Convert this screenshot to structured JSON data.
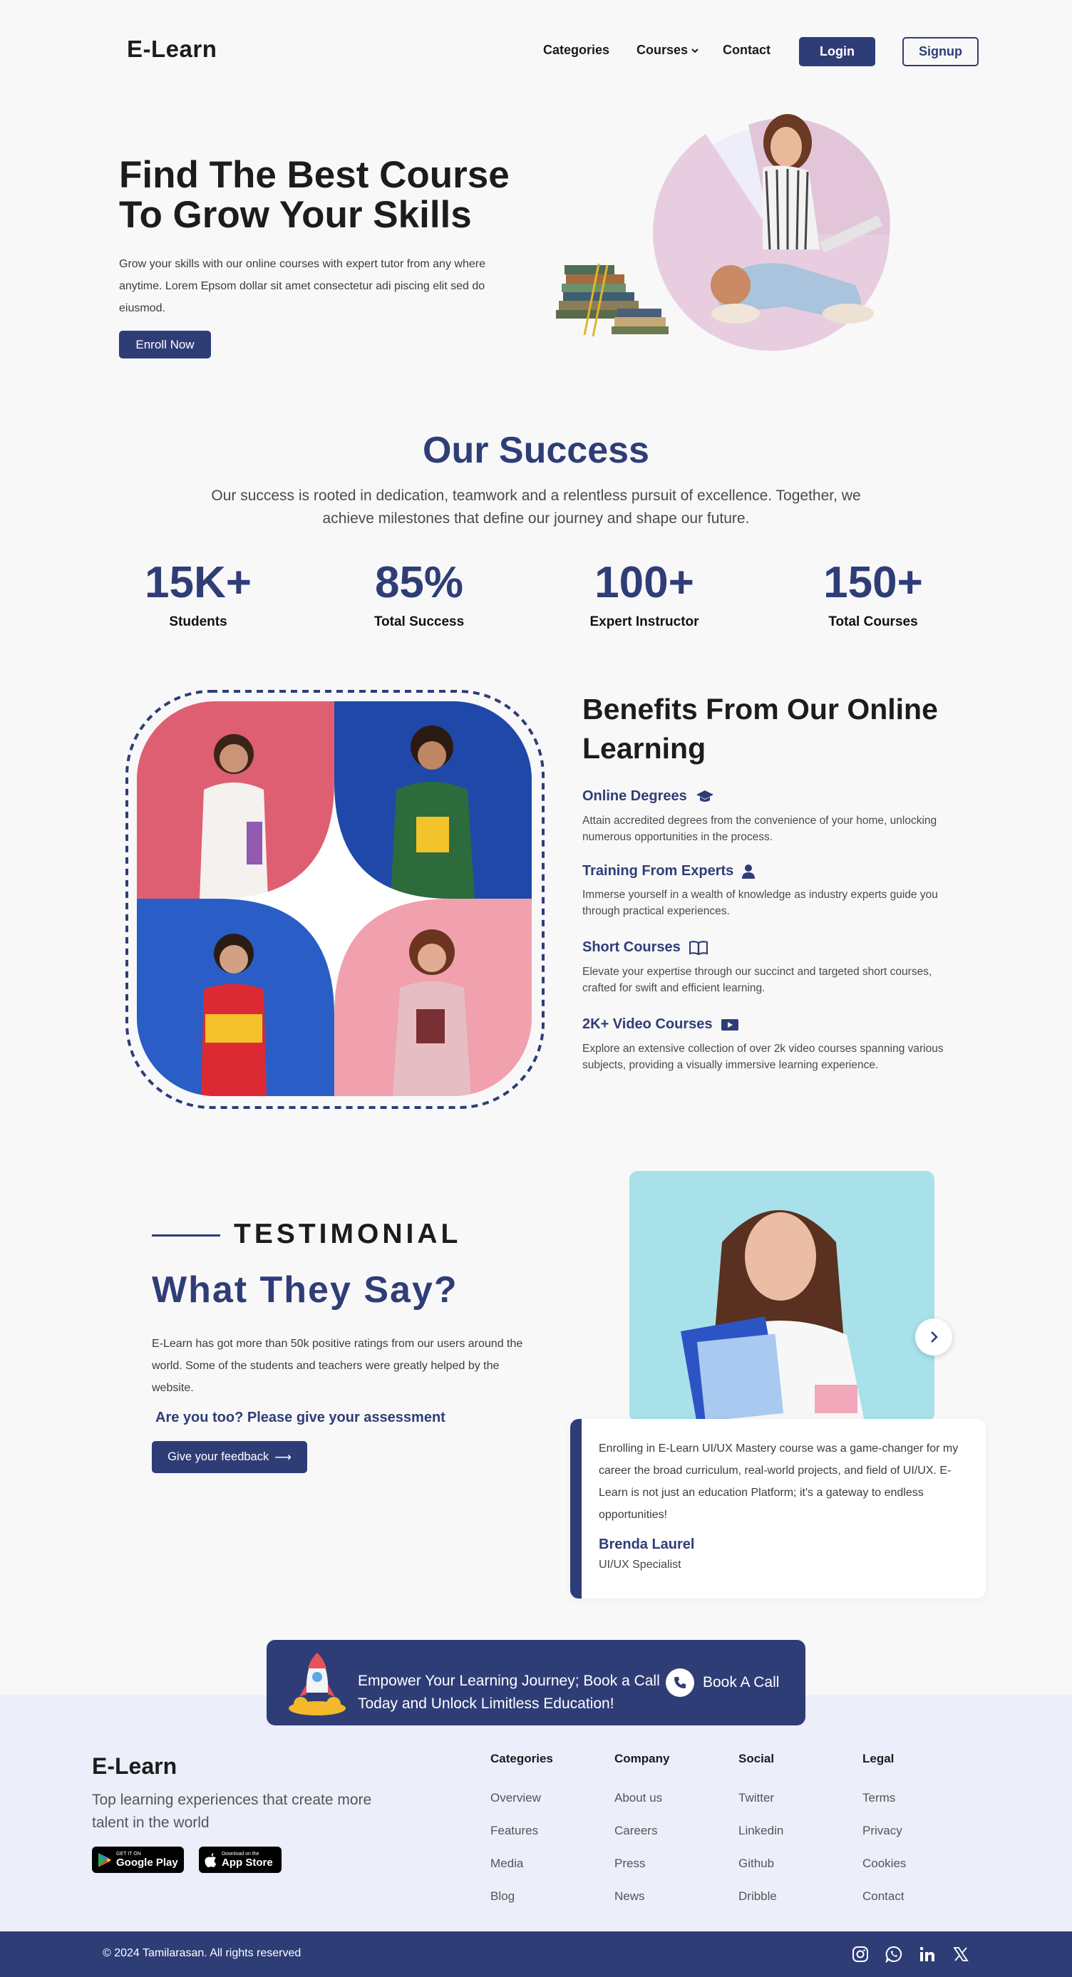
{
  "nav": {
    "logo": "E-Learn",
    "links": [
      "Categories",
      "Courses",
      "Contact"
    ],
    "login": "Login",
    "signup": "Signup"
  },
  "hero": {
    "title_line1": "Find The Best Course",
    "title_line2": "To Grow Your Skills",
    "description": "Grow your skills with our online courses with expert tutor from any where anytime. Lorem Epsom dollar sit amet consectetur adi piscing elit sed do eiusmod.",
    "cta": "Enroll Now"
  },
  "success": {
    "title": "Our Success",
    "description": "Our success is rooted in dedication, teamwork and a relentless pursuit of excellence. Together, we achieve milestones that define our journey and shape our future.",
    "stats": [
      {
        "value": "15K+",
        "label": "Students"
      },
      {
        "value": "85%",
        "label": "Total Success"
      },
      {
        "value": "100+",
        "label": "Expert Instructor"
      },
      {
        "value": "150+",
        "label": "Total Courses"
      }
    ]
  },
  "benefits": {
    "title": "Benefits From Our Online Learning",
    "items": [
      {
        "title": "Online Degrees",
        "icon": "graduation-cap-icon",
        "desc": "Attain accredited degrees from the convenience of your home, unlocking numerous opportunities in the process."
      },
      {
        "title": "Training From Experts",
        "icon": "user-icon",
        "desc": "Immerse yourself in a wealth of knowledge as industry experts guide you through practical experiences."
      },
      {
        "title": "Short Courses",
        "icon": "book-open-icon",
        "desc": "Elevate your expertise through our succinct and targeted short courses, crafted for swift and efficient learning."
      },
      {
        "title": "2K+ Video Courses",
        "icon": "video-icon",
        "desc": "Explore an extensive collection of over 2k video courses spanning various subjects, providing a visually immersive learning experience."
      }
    ]
  },
  "testimonial": {
    "label": "TESTIMONIAL",
    "title": "What They Say?",
    "description": "E-Learn has got more than 50k positive ratings from our users around the world. Some of the students and teachers were greatly helped by the website.",
    "ask": "Are you too? Please give your assessment",
    "cta": "Give your feedback",
    "arrow": "⟶",
    "quote": "Enrolling in E-Learn UI/UX Mastery course was a game-changer for my career the broad curriculum, real-world projects, and field of UI/UX. E-Learn is not just an education Platform; it's a gateway to endless opportunities!",
    "name": "Brenda Laurel",
    "role": "UI/UX Specialist"
  },
  "cta": {
    "text": "Empower Your Learning Journey; Book a Call Today and Unlock Limitless Education!",
    "button": "Book A Call"
  },
  "footer": {
    "logo": "E-Learn",
    "tagline": "Top learning experiences that create more talent in the world",
    "google_small": "GET IT ON",
    "google_big": "Google Play",
    "apple_small": "Download on the",
    "apple_big": "App Store",
    "columns": [
      {
        "title": "Categories",
        "links": [
          "Overview",
          "Features",
          "Media",
          "Blog"
        ]
      },
      {
        "title": "Company",
        "links": [
          "About us",
          "Careers",
          "Press",
          "News"
        ]
      },
      {
        "title": "Social",
        "links": [
          "Twitter",
          "Linkedin",
          "Github",
          "Dribble"
        ]
      },
      {
        "title": "Legal",
        "links": [
          "Terms",
          "Privacy",
          "Cookies",
          "Contact"
        ]
      }
    ],
    "copyright": "© 2024 Tamilarasan. All rights reserved"
  },
  "colors": {
    "primary": "#2f3d77",
    "background": "#f8f8f9",
    "footer_bg": "#eceefa",
    "hero_blob": "#e8cde0"
  }
}
